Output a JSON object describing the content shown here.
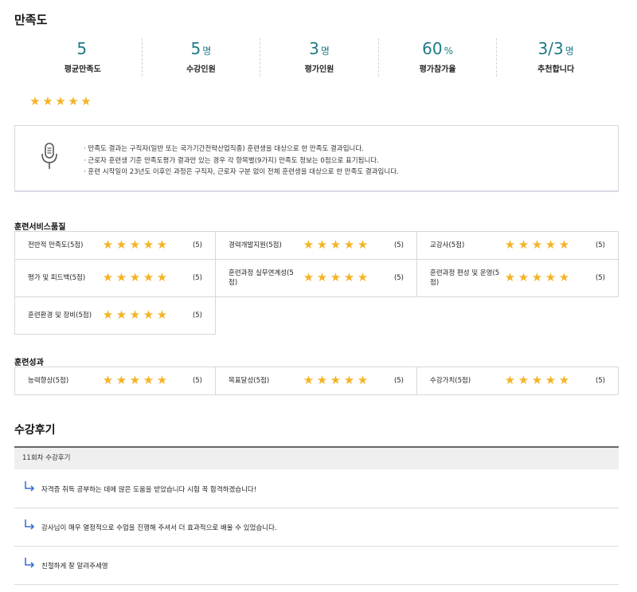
{
  "page": {
    "title": "만족도"
  },
  "stats": [
    {
      "value": "5",
      "unit": "",
      "label": "평균만족도"
    },
    {
      "value": "5",
      "unit": "명",
      "label": "수강인원"
    },
    {
      "value": "3",
      "unit": "명",
      "label": "평가인원"
    },
    {
      "value": "60",
      "unit": "%",
      "label": "평가참가율"
    },
    {
      "value": "3/3",
      "unit": "명",
      "label": "추천합니다"
    }
  ],
  "overall_rating": 5,
  "star_color": "#f5b324",
  "accent_color": "#1e7a85",
  "notice": {
    "icon": "microphone-icon",
    "lines": [
      "· 만족도 결과는 구직자(일반 또는 국가기간전략산업직종) 훈련생을 대상으로 한 만족도 결과입니다.",
      "· 근로자 훈련생 기준 만족도평가 결과만 있는 경우 각 항목별(9가지) 만족도 정보는 0점으로 표기됩니다.",
      "· 훈련 시작일이 23년도 이후인 과정은 구직자, 근로자 구분 없이 전체 훈련생을 대상으로 한 만족도 결과입니다."
    ]
  },
  "service_quality": {
    "label": "훈련서비스품질",
    "items": [
      {
        "name": "전반적 만족도(5점)",
        "rating": 5,
        "score": "(5)"
      },
      {
        "name": "경력개발지원(5점)",
        "rating": 5,
        "score": "(5)"
      },
      {
        "name": "교강사(5점)",
        "rating": 5,
        "score": "(5)"
      },
      {
        "name": "평가 및 피드백(5점)",
        "rating": 5,
        "score": "(5)"
      },
      {
        "name": "훈련과정 실무연계성(5점)",
        "rating": 5,
        "score": "(5)"
      },
      {
        "name": "훈련과정 편성 및 운영(5점)",
        "rating": 5,
        "score": "(5)"
      },
      {
        "name": "훈련환경 및 장비(5점)",
        "rating": 5,
        "score": "(5)"
      }
    ]
  },
  "outcomes": {
    "label": "훈련성과",
    "items": [
      {
        "name": "능력향상(5점)",
        "rating": 5,
        "score": "(5)"
      },
      {
        "name": "목표달성(5점)",
        "rating": 5,
        "score": "(5)"
      },
      {
        "name": "수강가치(5점)",
        "rating": 5,
        "score": "(5)"
      }
    ]
  },
  "reviews": {
    "title": "수강후기",
    "session_label": "11회차 수강후기",
    "items": [
      "자격증 취득 공부하는 데에 많은 도움을 받았습니다 시험 꼭 합격하겠습니다!",
      "강사님이 매우 열정적으로 수업을 진행해 주셔서 더 효과적으로 배울 수 있었습니다.",
      "친절하게 잘 알려주세영"
    ]
  }
}
